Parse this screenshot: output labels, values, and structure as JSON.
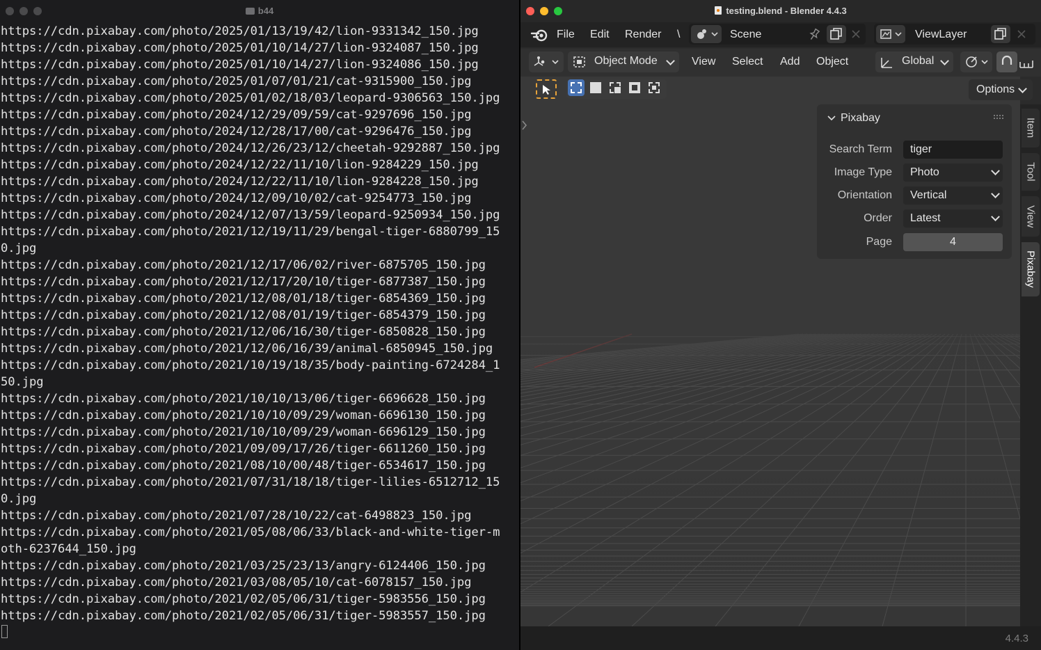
{
  "terminal": {
    "title": "b44",
    "lines": [
      "https://cdn.pixabay.com/photo/2025/01/13/19/42/lion-9331342_150.jpg",
      "https://cdn.pixabay.com/photo/2025/01/10/14/27/lion-9324087_150.jpg",
      "https://cdn.pixabay.com/photo/2025/01/10/14/27/lion-9324086_150.jpg",
      "https://cdn.pixabay.com/photo/2025/01/07/01/21/cat-9315900_150.jpg",
      "https://cdn.pixabay.com/photo/2025/01/02/18/03/leopard-9306563_150.jpg",
      "https://cdn.pixabay.com/photo/2024/12/29/09/59/cat-9297696_150.jpg",
      "https://cdn.pixabay.com/photo/2024/12/28/17/00/cat-9296476_150.jpg",
      "https://cdn.pixabay.com/photo/2024/12/26/23/12/cheetah-9292887_150.jpg",
      "https://cdn.pixabay.com/photo/2024/12/22/11/10/lion-9284229_150.jpg",
      "https://cdn.pixabay.com/photo/2024/12/22/11/10/lion-9284228_150.jpg",
      "https://cdn.pixabay.com/photo/2024/12/09/10/02/cat-9254773_150.jpg",
      "https://cdn.pixabay.com/photo/2024/12/07/13/59/leopard-9250934_150.jpg",
      "https://cdn.pixabay.com/photo/2021/12/19/11/29/bengal-tiger-6880799_15",
      "0.jpg",
      "https://cdn.pixabay.com/photo/2021/12/17/06/02/river-6875705_150.jpg",
      "https://cdn.pixabay.com/photo/2021/12/17/20/10/tiger-6877387_150.jpg",
      "https://cdn.pixabay.com/photo/2021/12/08/01/18/tiger-6854369_150.jpg",
      "https://cdn.pixabay.com/photo/2021/12/08/01/19/tiger-6854379_150.jpg",
      "https://cdn.pixabay.com/photo/2021/12/06/16/30/tiger-6850828_150.jpg",
      "https://cdn.pixabay.com/photo/2021/12/06/16/39/animal-6850945_150.jpg",
      "https://cdn.pixabay.com/photo/2021/10/19/18/35/body-painting-6724284_1",
      "50.jpg",
      "https://cdn.pixabay.com/photo/2021/10/10/13/06/tiger-6696628_150.jpg",
      "https://cdn.pixabay.com/photo/2021/10/10/09/29/woman-6696130_150.jpg",
      "https://cdn.pixabay.com/photo/2021/10/10/09/29/woman-6696129_150.jpg",
      "https://cdn.pixabay.com/photo/2021/09/09/17/26/tiger-6611260_150.jpg",
      "https://cdn.pixabay.com/photo/2021/08/10/00/48/tiger-6534617_150.jpg",
      "https://cdn.pixabay.com/photo/2021/07/31/18/18/tiger-lilies-6512712_15",
      "0.jpg",
      "https://cdn.pixabay.com/photo/2021/07/28/10/22/cat-6498823_150.jpg",
      "https://cdn.pixabay.com/photo/2021/05/08/06/33/black-and-white-tiger-m",
      "oth-6237644_150.jpg",
      "https://cdn.pixabay.com/photo/2021/03/25/23/13/angry-6124406_150.jpg",
      "https://cdn.pixabay.com/photo/2021/03/08/05/10/cat-6078157_150.jpg",
      "https://cdn.pixabay.com/photo/2021/02/05/06/31/tiger-5983556_150.jpg",
      "https://cdn.pixabay.com/photo/2021/02/05/06/31/tiger-5983557_150.jpg"
    ]
  },
  "blender": {
    "window_title": "testing.blend - Blender 4.4.3",
    "menus": {
      "file": "File",
      "edit": "Edit",
      "render": "Render",
      "overflow": "\\"
    },
    "scene_name": "Scene",
    "view_layer": "ViewLayer",
    "header": {
      "mode": "Object Mode",
      "view": "View",
      "select": "Select",
      "add": "Add",
      "object": "Object",
      "orientation": "Global",
      "options": "Options"
    },
    "n_panel_tabs": [
      "Item",
      "Tool",
      "View",
      "Pixabay"
    ],
    "pixabay_panel": {
      "title": "Pixabay",
      "search_term_label": "Search Term",
      "search_term_value": "tiger",
      "image_type_label": "Image Type",
      "image_type_value": "Photo",
      "orientation_label": "Orientation",
      "orientation_value": "Vertical",
      "order_label": "Order",
      "order_value": "Latest",
      "page_label": "Page",
      "page_value": "4"
    },
    "version": "4.4.3",
    "colors": {
      "accent": "#4772b3",
      "close": "#ff5f57",
      "minimize": "#febc2e",
      "zoom": "#28c840"
    }
  }
}
